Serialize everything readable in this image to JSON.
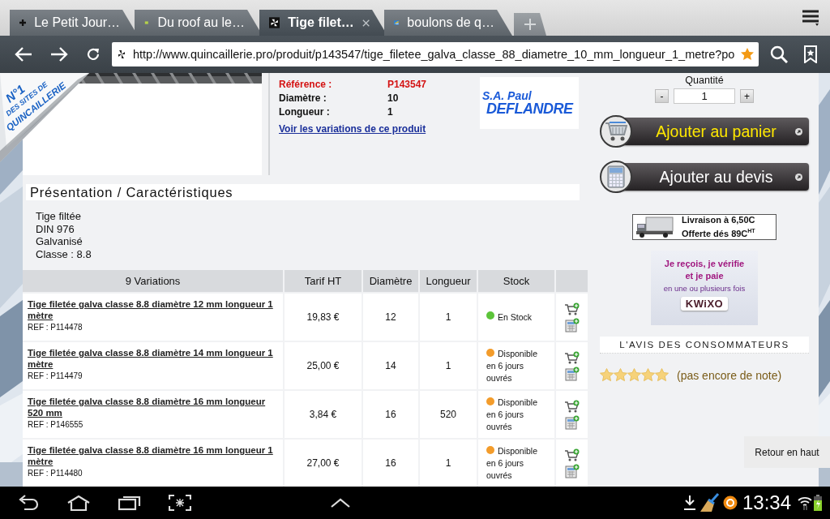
{
  "tabs": [
    {
      "label": "Le Petit Jour…",
      "kind": "plus",
      "selected": false
    },
    {
      "label": "Du roof au le…",
      "kind": "dot",
      "selected": false
    },
    {
      "label": "Tige filet…",
      "kind": "pinwheel",
      "selected": true
    },
    {
      "label": "boulons de q…",
      "kind": "flag",
      "selected": false
    }
  ],
  "address_bar": {
    "url": "http://www.quincaillerie.pro/produit/p143547/tige_filetee_galva_classe_88_diametre_10_mm_longueur_1_metre?po"
  },
  "corner_badge": {
    "lines": [
      "N°1",
      "DES SITES DE",
      "QUINCAILLERIE"
    ]
  },
  "product": {
    "specs": [
      {
        "label": "Référence :",
        "value": "P143547",
        "highlighted": true
      },
      {
        "label": "Diamètre :",
        "value": "10",
        "highlighted": false
      },
      {
        "label": "Longueur :",
        "value": "1",
        "highlighted": false
      }
    ],
    "variations_link": "Voir les variations de ce produit",
    "brand_logo": {
      "line_1": "S.A. Paul",
      "line_2": "DEFLANDRE"
    }
  },
  "presentation": {
    "title": "Présentation / Caractéristiques",
    "lines": [
      "Tige filtée",
      "DIN 976",
      "Galvanisé",
      "Classe : 8.8"
    ]
  },
  "variations_table": {
    "columns": [
      "9 Variations",
      "Tarif HT",
      "Diamètre",
      "Longueur",
      "Stock"
    ],
    "rows": [
      {
        "name": "Tige filetée galva classe 8.8 diamètre 12 mm longueur 1 mètre",
        "ref": "REF : P114478",
        "price": "19,83 €",
        "diameter": "12",
        "length": "1",
        "stock": {
          "text": "En Stock",
          "color": "#5cc43a"
        }
      },
      {
        "name": "Tige filetée galva classe 8.8 diamètre 14 mm longueur 1 mètre",
        "ref": "REF : P114479",
        "price": "25,00 €",
        "diameter": "14",
        "length": "1",
        "stock": {
          "text": "Disponible en 6 jours ouvrés",
          "color": "#f39c2b"
        }
      },
      {
        "name": "Tige filetée galva classe 8.8 diamètre 16 mm longueur 520 mm",
        "ref": "REF : P146555",
        "price": "3,84 €",
        "diameter": "16",
        "length": "520",
        "stock": {
          "text": "Disponible en 6 jours ouvrés",
          "color": "#f39c2b"
        }
      },
      {
        "name": "Tige filetée galva classe 8.8 diamètre 16 mm longueur 1 mètre",
        "ref": "REF : P114480",
        "price": "27,00 €",
        "diameter": "16",
        "length": "1",
        "stock": {
          "text": "Disponible en 6 jours ouvrés",
          "color": "#f39c2b"
        }
      }
    ]
  },
  "side_panel": {
    "quantity": {
      "label": "Quantité",
      "minus": "-",
      "value": "1",
      "plus": "+"
    },
    "buttons": [
      {
        "label": "Ajouter au panier",
        "kind": "cart"
      },
      {
        "label": "Ajouter au devis",
        "kind": "quote"
      }
    ],
    "delivery_banner": {
      "line_1": "Livraison à 6,50C",
      "line_2": "Offerte dés 89C$^{HT}$"
    },
    "payment_banner": {
      "lines": [
        "Je reçois, je vérifie",
        "et je paie",
        "en une ou plusieurs fois"
      ],
      "logo": "KWiXO"
    },
    "reviews": {
      "title": "L'AVIS DES CONSOMMATEURS",
      "stars": 5,
      "note": "(pas encore de note)"
    }
  },
  "back_to_top": "Retour en haut",
  "status_bar": {
    "time": "13:34"
  }
}
